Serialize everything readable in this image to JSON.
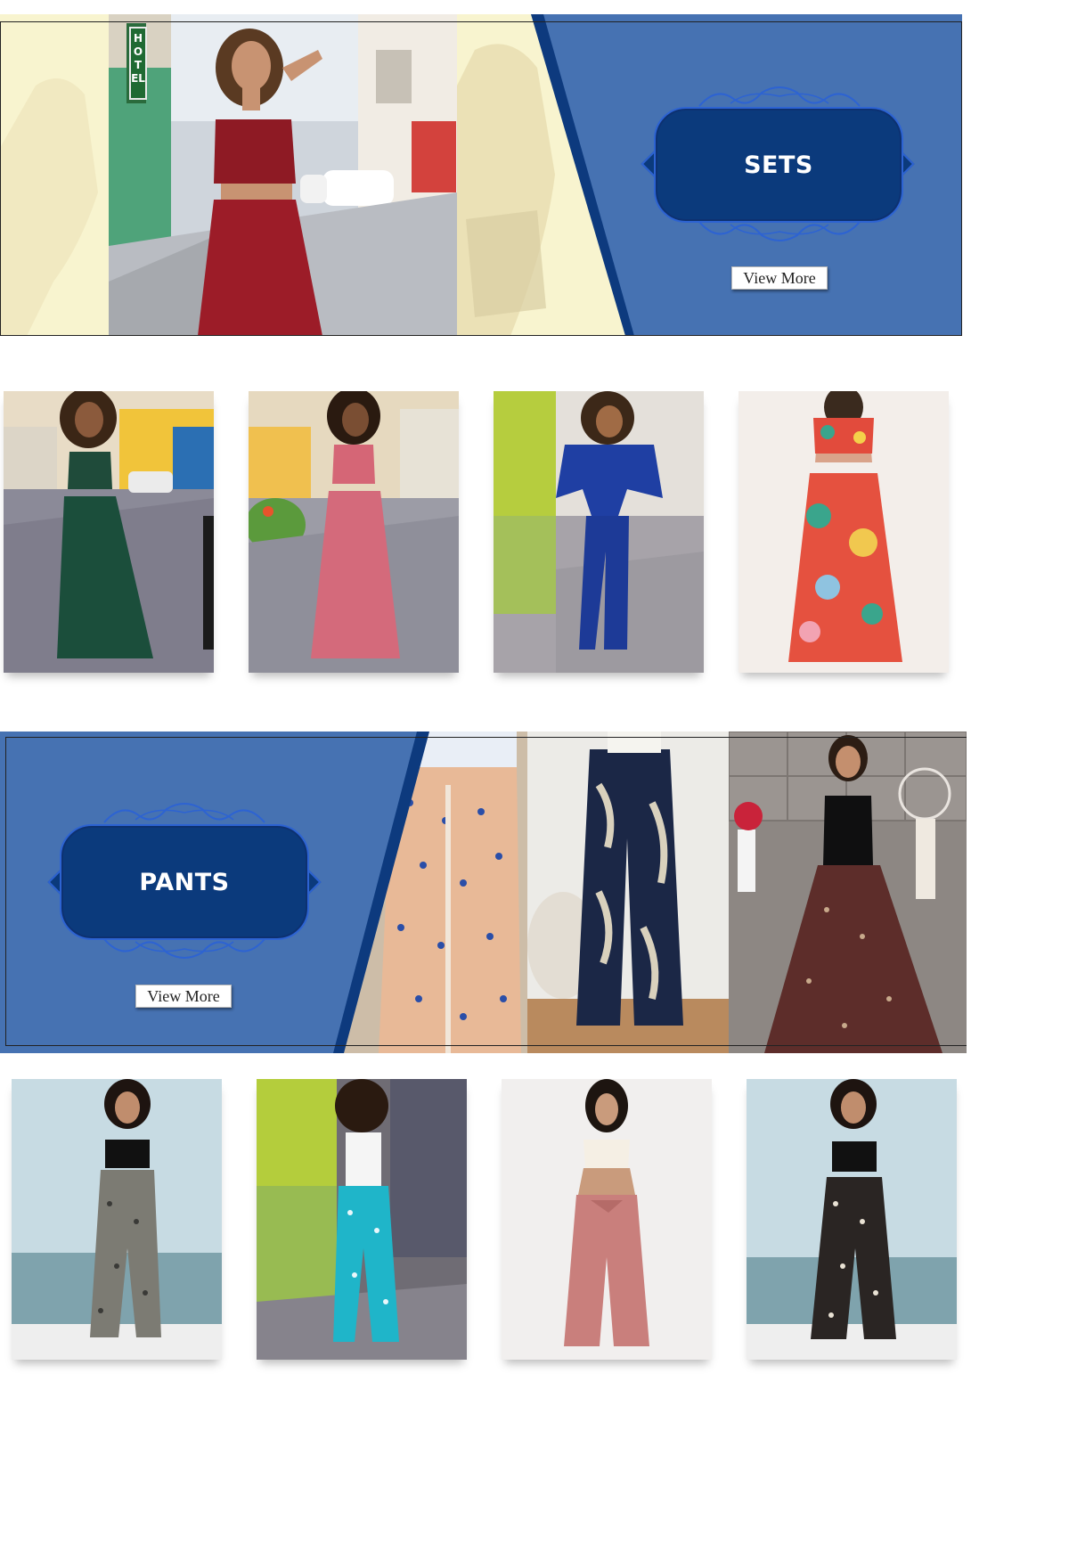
{
  "sections": {
    "sets": {
      "title": "SETS",
      "view_more_label": "View More",
      "accent_color": "#4672b2",
      "title_box_color": "#0b3a7c"
    },
    "pants": {
      "title": "PANTS",
      "view_more_label": "View More",
      "accent_color": "#4672b2",
      "title_box_color": "#0b3a7c"
    }
  },
  "hero_sets": {
    "sign_text": "HOTEL"
  },
  "sets_products": [
    {
      "name": "green-halter-skirt-set"
    },
    {
      "name": "pink-crop-pants-set"
    },
    {
      "name": "blue-wrap-top-pants-set"
    },
    {
      "name": "tropical-print-set"
    }
  ],
  "pants_products": [
    {
      "name": "grey-print-harem-pants"
    },
    {
      "name": "turquoise-print-pants"
    },
    {
      "name": "pink-belted-pants"
    },
    {
      "name": "black-print-split-pants"
    }
  ]
}
